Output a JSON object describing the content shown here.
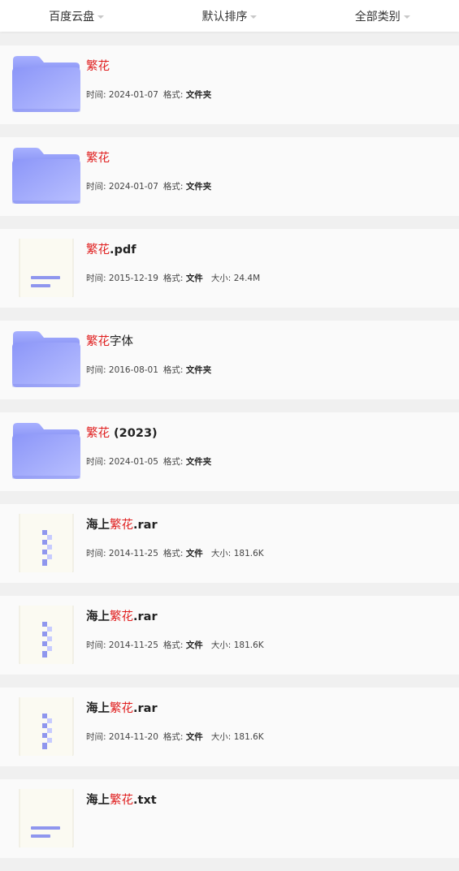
{
  "filters": [
    {
      "label": "百度云盘",
      "id": "source"
    },
    {
      "label": "默认排序",
      "id": "sort"
    },
    {
      "label": "全部类别",
      "id": "category"
    }
  ],
  "labels": {
    "time": "时间: ",
    "format": "格式: ",
    "size": "大小: "
  },
  "results": [
    {
      "icon": "folder",
      "pre": "",
      "hl": "繁花",
      "post": "",
      "bold": false,
      "time": "2024-01-07",
      "format": "文件夹",
      "size": ""
    },
    {
      "icon": "folder",
      "pre": "",
      "hl": "繁花",
      "post": "",
      "bold": false,
      "time": "2024-01-07",
      "format": "文件夹",
      "size": ""
    },
    {
      "icon": "document",
      "pre": "",
      "hl": "繁花",
      "post": ".pdf",
      "bold": true,
      "time": "2015-12-19",
      "format": "文件",
      "size": "24.4M"
    },
    {
      "icon": "folder",
      "pre": "",
      "hl": "繁花",
      "post": "字体",
      "bold": false,
      "time": "2016-08-01",
      "format": "文件夹",
      "size": ""
    },
    {
      "icon": "folder",
      "pre": "",
      "hl": "繁花",
      "post": " (2023)",
      "bold": true,
      "time": "2024-01-05",
      "format": "文件夹",
      "size": ""
    },
    {
      "icon": "archive",
      "pre": "海上",
      "hl": "繁花",
      "post": ".rar",
      "bold": true,
      "time": "2014-11-25",
      "format": "文件",
      "size": "181.6K"
    },
    {
      "icon": "archive",
      "pre": "海上",
      "hl": "繁花",
      "post": ".rar",
      "bold": true,
      "time": "2014-11-25",
      "format": "文件",
      "size": "181.6K"
    },
    {
      "icon": "archive",
      "pre": "海上",
      "hl": "繁花",
      "post": ".rar",
      "bold": true,
      "time": "2014-11-20",
      "format": "文件",
      "size": "181.6K"
    },
    {
      "icon": "document",
      "pre": "海上",
      "hl": "繁花",
      "post": ".txt",
      "bold": true,
      "time": "",
      "format": "",
      "size": ""
    }
  ]
}
